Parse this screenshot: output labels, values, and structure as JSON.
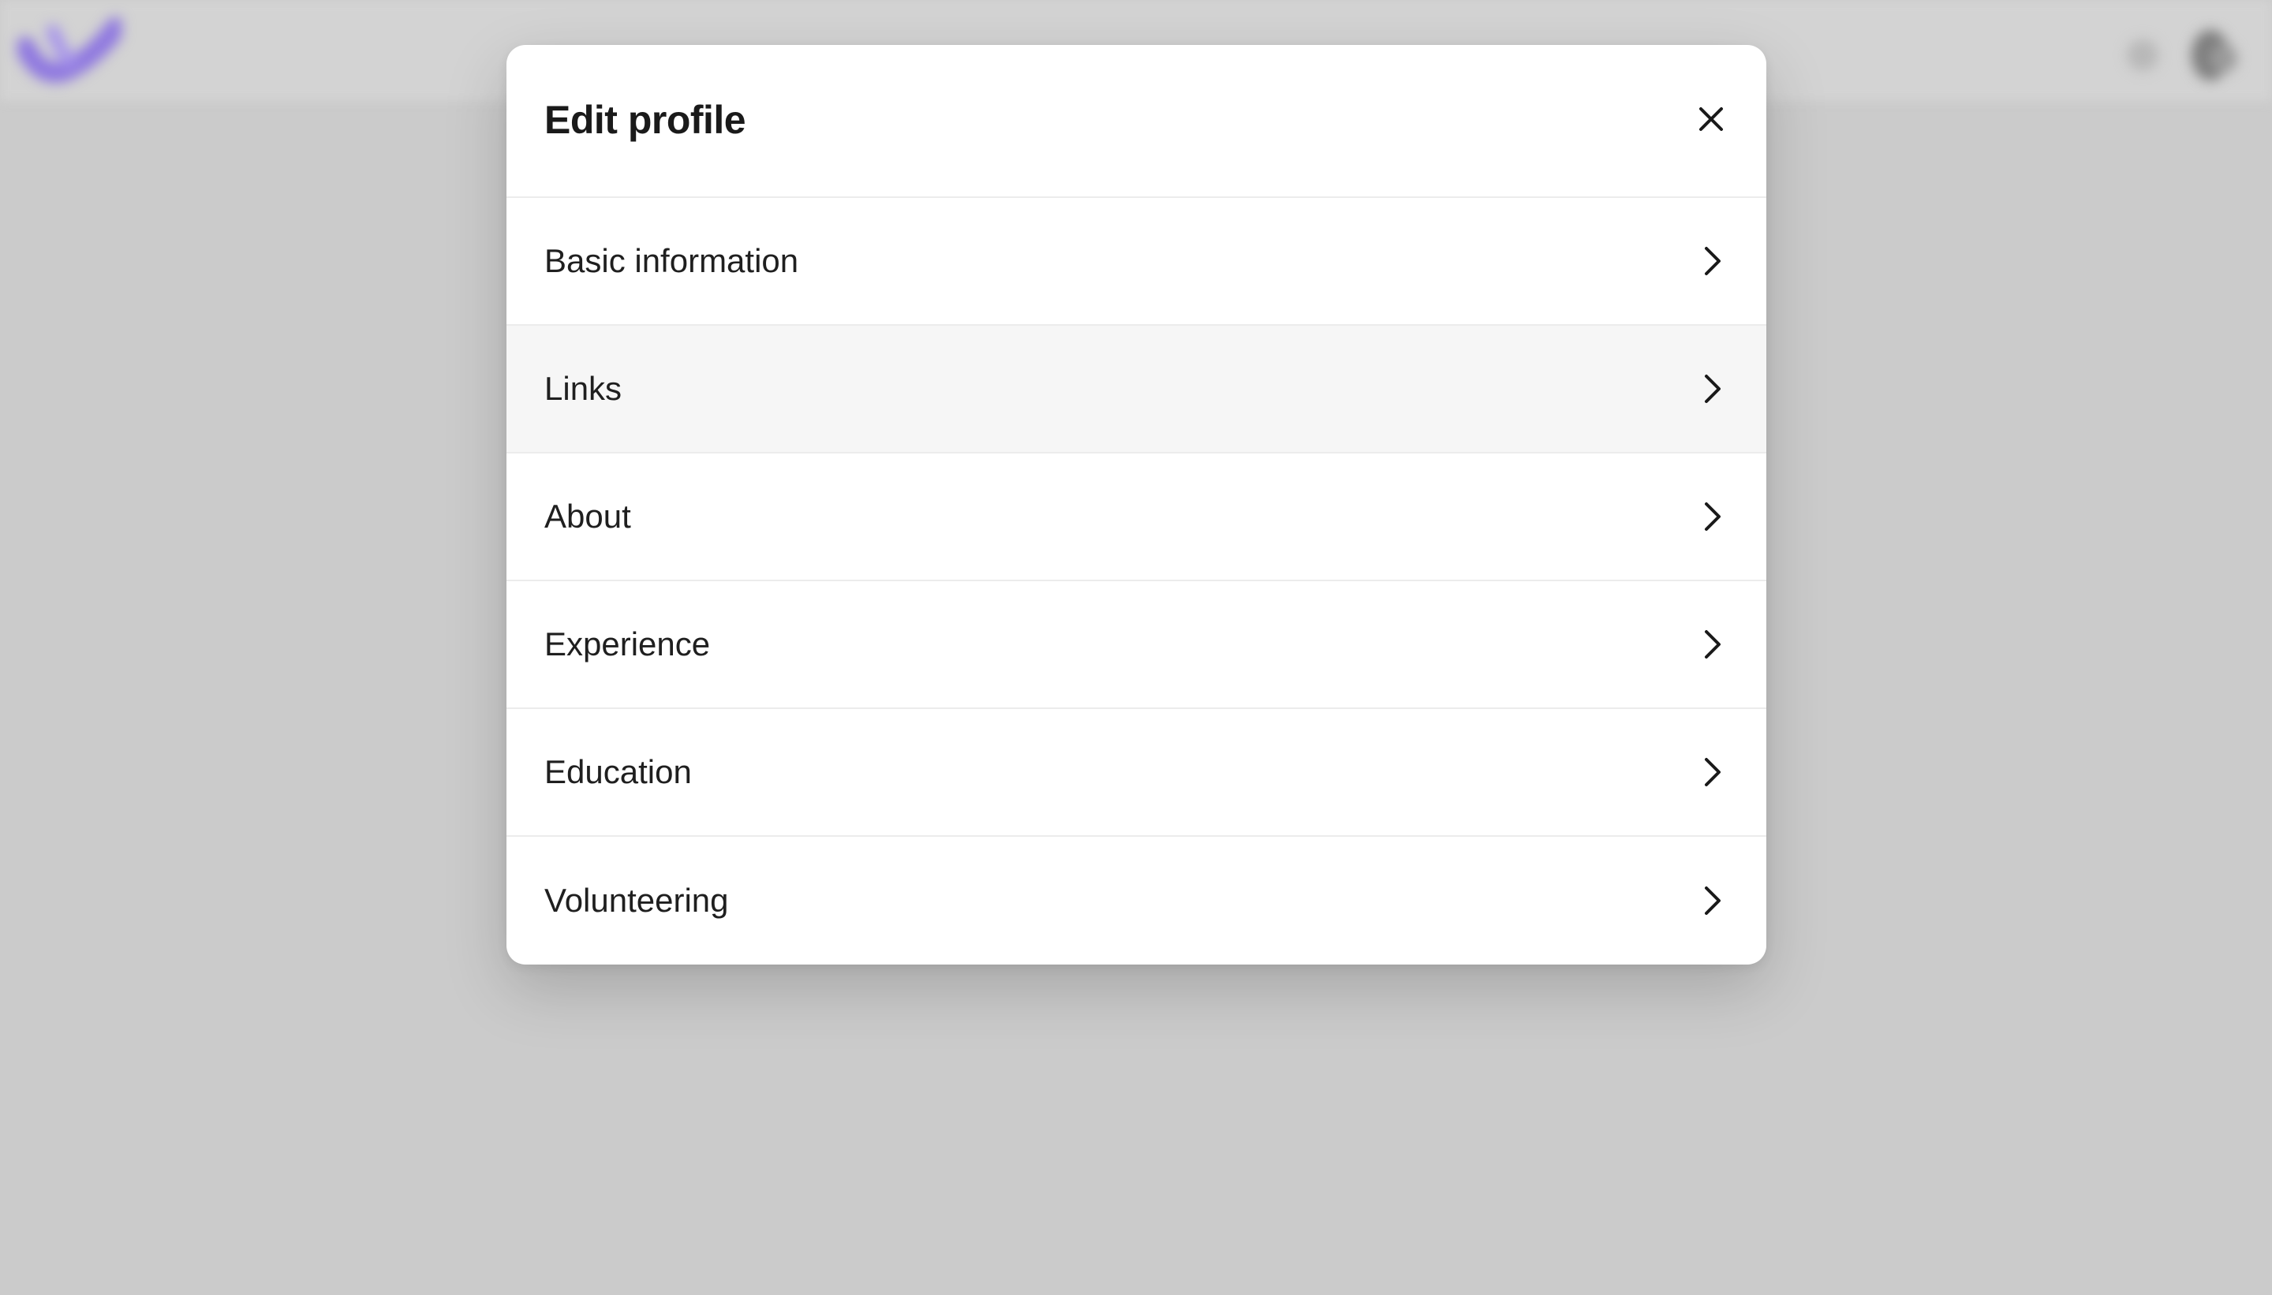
{
  "background": {
    "logo_icon": "brand-check-logo",
    "header_icons": [
      "notification-icon",
      "user-avatar"
    ],
    "logo_color": "#8f78e0"
  },
  "modal": {
    "title": "Edit profile",
    "close_icon": "close-icon",
    "items": [
      {
        "label": "Basic information",
        "icon": "chevron-right-icon",
        "hovered": false
      },
      {
        "label": "Links",
        "icon": "chevron-right-icon",
        "hovered": true
      },
      {
        "label": "About",
        "icon": "chevron-right-icon",
        "hovered": false
      },
      {
        "label": "Experience",
        "icon": "chevron-right-icon",
        "hovered": false
      },
      {
        "label": "Education",
        "icon": "chevron-right-icon",
        "hovered": false
      },
      {
        "label": "Volunteering",
        "icon": "chevron-right-icon",
        "hovered": false
      }
    ]
  }
}
